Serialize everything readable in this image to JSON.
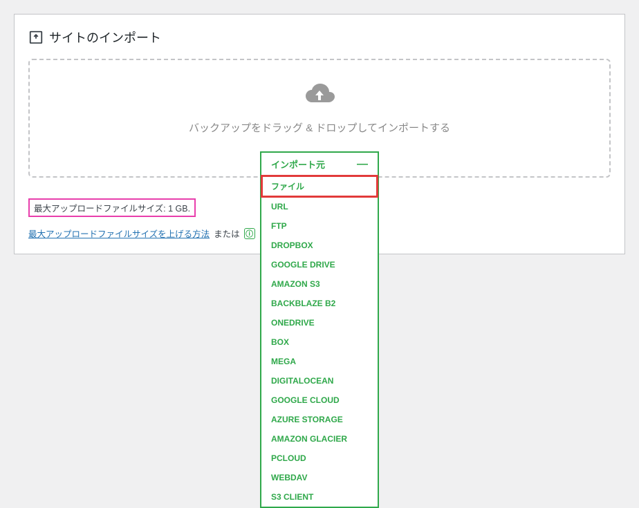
{
  "header": {
    "title": "サイトのインポート"
  },
  "dropzone": {
    "text": "バックアップをドラッグ & ドロップしてインポートする"
  },
  "dropdown": {
    "label": "インポート元",
    "items": [
      "ファイル",
      "URL",
      "FTP",
      "DROPBOX",
      "GOOGLE DRIVE",
      "AMAZON S3",
      "BACKBLAZE B2",
      "ONEDRIVE",
      "BOX",
      "MEGA",
      "DIGITALOCEAN",
      "GOOGLE CLOUD",
      "AZURE STORAGE",
      "AMAZON GLACIER",
      "PCLOUD",
      "WEBDAV",
      "S3 CLIENT"
    ]
  },
  "maxsize": {
    "label": "最大アップロードファイルサイズ:",
    "value": "1 GB."
  },
  "help": {
    "link_text": "最大アップロードファイルサイズを上げる方法",
    "or_text": "または",
    "info_symbol": "ⓘ"
  }
}
